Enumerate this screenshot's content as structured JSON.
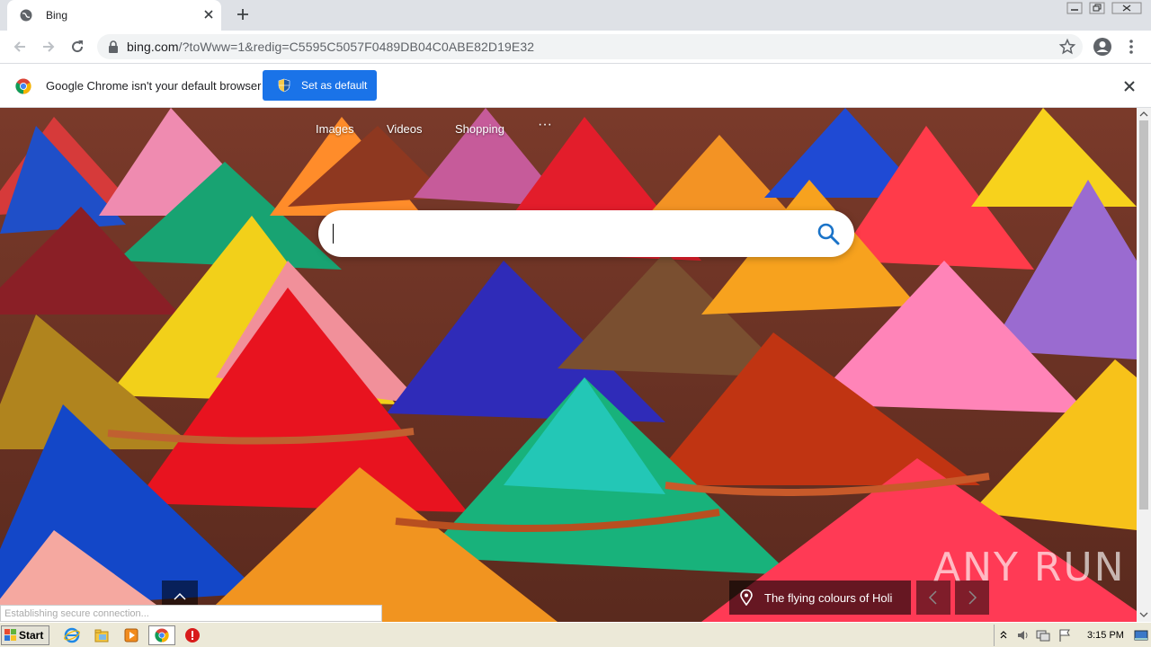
{
  "tab": {
    "title": "Bing"
  },
  "omnibox": {
    "url_host": "bing.com",
    "url_path": "/?toWww=1&redig=C5595C5057F0489DB04C0ABE82D19E32"
  },
  "infobar": {
    "message": "Google Chrome isn't your default browser",
    "button_label": "Set as default"
  },
  "bing": {
    "nav": [
      "Images",
      "Videos",
      "Shopping",
      "···"
    ],
    "search_placeholder": "",
    "caption": "The flying colours of Holi",
    "watermark": "ANY RUN"
  },
  "status_bar": {
    "text": "Establishing secure connection..."
  },
  "taskbar": {
    "start_label": "Start",
    "clock": "3:15 PM"
  },
  "colors": {
    "accent": "#1a73e8",
    "tabstrip": "#dee1e6",
    "taskbar": "#ece9d8"
  }
}
